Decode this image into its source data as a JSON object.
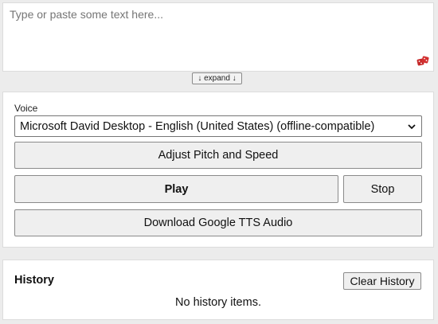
{
  "input": {
    "placeholder": "Type or paste some text here...",
    "value": "",
    "dice_icon": "dice-icon",
    "dice_color": "#c62828"
  },
  "expand_label": "↓ expand ↓",
  "voice": {
    "label": "Voice",
    "selected": "Microsoft David Desktop - English (United States) (offline-compatible)",
    "chevron_icon": "chevron-down-icon"
  },
  "buttons": {
    "pitch": "Adjust Pitch and Speed",
    "play": "Play",
    "stop": "Stop",
    "download": "Download Google TTS Audio"
  },
  "history": {
    "title": "History",
    "clear": "Clear History",
    "empty": "No history items."
  }
}
